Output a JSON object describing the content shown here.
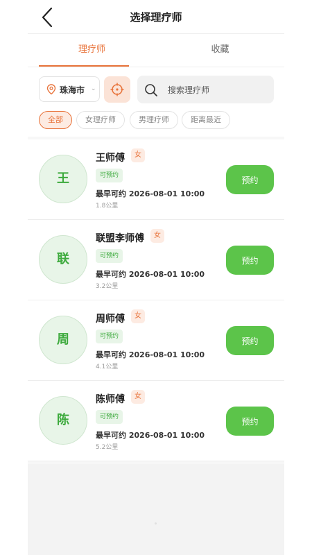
{
  "header": {
    "title": "选择理疗师"
  },
  "tabs": [
    {
      "label": "理疗师"
    },
    {
      "label": "收藏"
    }
  ],
  "filter": {
    "city": "珠海市",
    "search_placeholder": "搜索理疗师",
    "chips": [
      {
        "label": "全部"
      },
      {
        "label": "女理疗师"
      },
      {
        "label": "男理疗师"
      },
      {
        "label": "距离最近"
      }
    ]
  },
  "therapists": [
    {
      "initial": "王",
      "name": "王师傅",
      "gender": "女",
      "status": "可预约",
      "earliest": "最早可约 2026-08-01 10:00",
      "distance": "1.8公里",
      "button": "预约"
    },
    {
      "initial": "联",
      "name": "联盟李师傅",
      "gender": "女",
      "status": "可预约",
      "earliest": "最早可约 2026-08-01 10:00",
      "distance": "3.2公里",
      "button": "预约"
    },
    {
      "initial": "周",
      "name": "周师傅",
      "gender": "女",
      "status": "可预约",
      "earliest": "最早可约 2026-08-01 10:00",
      "distance": "4.1公里",
      "button": "预约"
    },
    {
      "initial": "陈",
      "name": "陈师傅",
      "gender": "女",
      "status": "可预约",
      "earliest": "最早可约 2026-08-01 10:00",
      "distance": "5.2公里",
      "button": "预约"
    }
  ],
  "colors": {
    "accent": "#e8733a",
    "book_button": "#5cc44a",
    "status_green": "#3daa3d"
  },
  "icons": {
    "back": "chevron-left-icon",
    "location": "map-pin-icon",
    "locate": "crosshair-icon",
    "search": "search-icon"
  }
}
